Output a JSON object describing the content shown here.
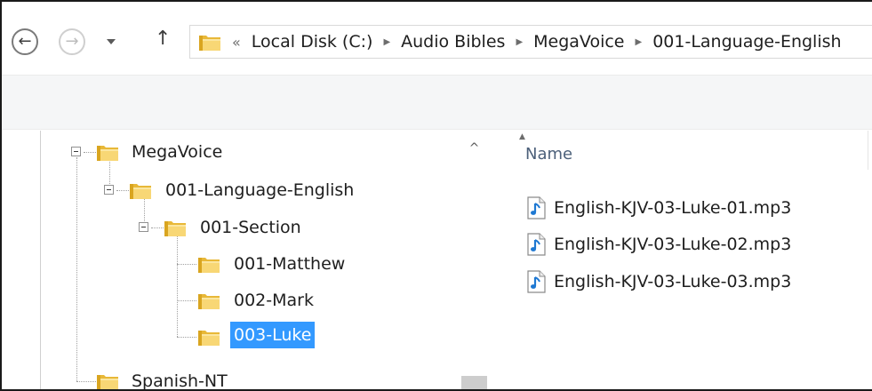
{
  "navigation": {
    "back_icon": "back-arrow-icon",
    "forward_icon": "forward-arrow-icon",
    "recent_icon": "chevron-down-icon",
    "up_icon": "up-arrow-icon"
  },
  "address_bar": {
    "overflow_label": "«",
    "breadcrumbs": [
      "Local Disk (C:)",
      "Audio Bibles",
      "MegaVoice",
      "001-Language-English"
    ]
  },
  "tree": {
    "megavoice": "MegaVoice",
    "language_english": "001-Language-English",
    "section": "001-Section",
    "matthew": "001-Matthew",
    "mark": "002-Mark",
    "luke": "003-Luke",
    "spanish": "Spanish-NT"
  },
  "file_list": {
    "column_name": "Name",
    "files": [
      "English-KJV-03-Luke-01.mp3",
      "English-KJV-03-Luke-02.mp3",
      "English-KJV-03-Luke-03.mp3"
    ]
  },
  "colors": {
    "selection": "#3399ff",
    "folder": "#e8b838",
    "audio_icon": "#1e78d2"
  }
}
